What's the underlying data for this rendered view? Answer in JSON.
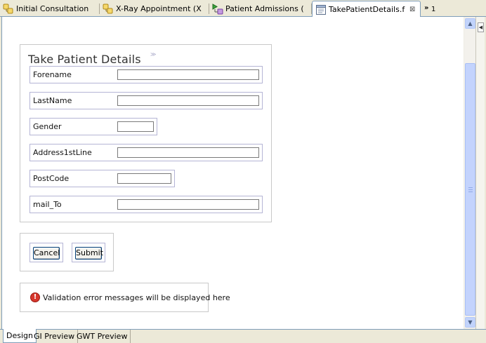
{
  "editor_tabs": [
    {
      "label": "Initial Consultation",
      "icon": "workflow-icon",
      "active": false
    },
    {
      "label": "X-Ray Appointment (X",
      "icon": "workflow-icon",
      "active": false
    },
    {
      "label": "Patient Admissions (",
      "icon": "process-flow-icon",
      "active": false
    },
    {
      "label": "TakePatientDetails.f",
      "icon": "form-file-icon",
      "active": true,
      "close": "⊠"
    }
  ],
  "overflow": {
    "chevron": "»",
    "count": "1"
  },
  "form": {
    "title": "Take Patient Details",
    "title_marker": "≫",
    "fields": [
      {
        "label": "Forename",
        "value": ""
      },
      {
        "label": "LastName",
        "value": ""
      },
      {
        "label": "Gender",
        "value": ""
      },
      {
        "label": "Address1stLine",
        "value": ""
      },
      {
        "label": "PostCode",
        "value": ""
      },
      {
        "label": "mail_To",
        "value": ""
      }
    ]
  },
  "buttons": {
    "cancel": "Cancel",
    "submit": "Submit"
  },
  "validation": {
    "icon_glyph": "!",
    "message": "Validation error messages will be displayed here"
  },
  "scrollbar": {
    "up": "▲",
    "down": "▼"
  },
  "side_panel": {
    "toggle": "◀"
  },
  "bottom_tabs": [
    {
      "label": "Design",
      "active": true
    },
    {
      "label": "GI Preview",
      "active": false
    },
    {
      "label": "GWT Preview",
      "active": false
    }
  ],
  "colors": {
    "accent_border": "#7f9db9",
    "field_border": "#b5b5d5",
    "error_icon": "#d6372d",
    "scroll_thumb": "#c3d3fd"
  }
}
